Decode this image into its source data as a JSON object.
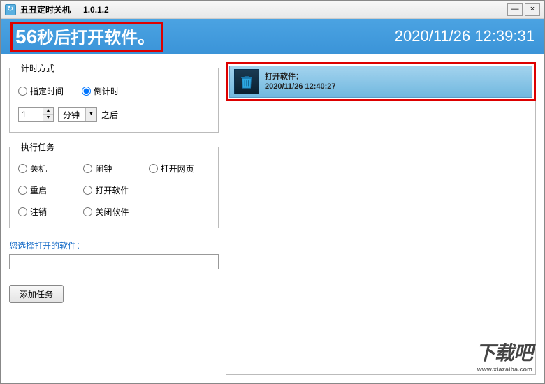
{
  "titlebar": {
    "title": "丑丑定时关机",
    "version": "1.0.1.2",
    "min": "—",
    "close": "×"
  },
  "banner": {
    "countdown_num": "56",
    "countdown_suffix": "秒后打开软件。",
    "datetime": "2020/11/26 12:39:31"
  },
  "timing": {
    "legend": "计时方式",
    "opt_fixed": "指定时间",
    "opt_countdown": "倒计时",
    "number_value": "1",
    "unit_value": "分钟",
    "after_label": "之后"
  },
  "tasks": {
    "legend": "执行任务",
    "shutdown": "关机",
    "alarm": "闹钟",
    "openweb": "打开网页",
    "restart": "重启",
    "openapp": "打开软件",
    "logout": "注销",
    "closeapp": "关闭软件"
  },
  "select_label": "您选择打开的软件：",
  "input_value": "",
  "add_button": "添加任务",
  "tasklist": {
    "item_title": "打开软件：",
    "item_time": "2020/11/26 12:40:27"
  },
  "watermark": {
    "main": "下载吧",
    "sub": "www.xiazaiba.com"
  }
}
